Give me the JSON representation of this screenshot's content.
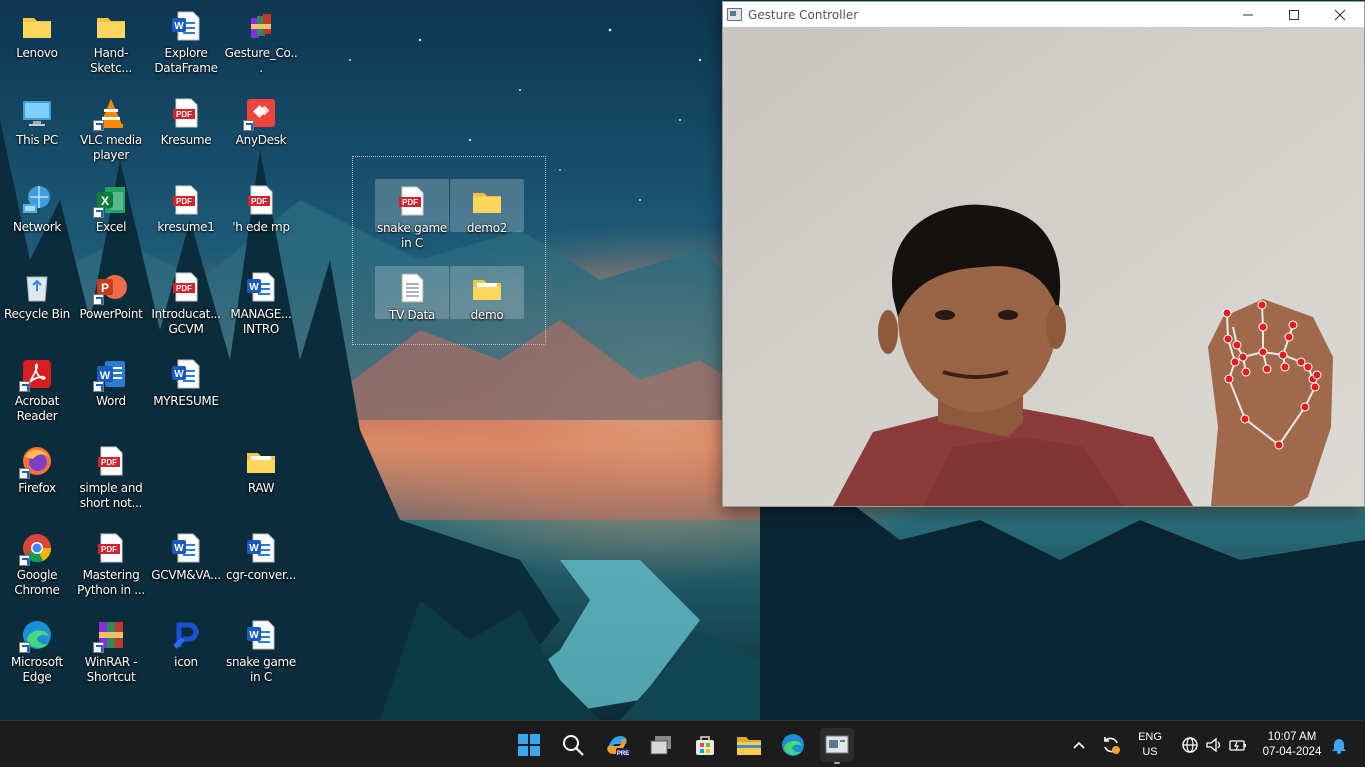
{
  "desktop": {
    "icons": [
      {
        "label": "Lenovo",
        "icon": "folder-icon"
      },
      {
        "label": "Hand-Sketc...",
        "icon": "folder-icon"
      },
      {
        "label": "Explore DataFrame",
        "icon": "word-doc-icon"
      },
      {
        "label": "Gesture_Co...",
        "icon": "winrar-archive-icon"
      },
      {
        "label": "This PC",
        "icon": "monitor-icon"
      },
      {
        "label": "VLC media player",
        "icon": "vlc-icon"
      },
      {
        "label": "Kresume",
        "icon": "pdf-icon"
      },
      {
        "label": "AnyDesk",
        "icon": "anydesk-icon"
      },
      {
        "label": "Network",
        "icon": "network-icon"
      },
      {
        "label": "Excel",
        "icon": "excel-icon"
      },
      {
        "label": "kresume1",
        "icon": "pdf-icon"
      },
      {
        "label": "'h ede mp",
        "icon": "pdf-icon"
      },
      {
        "label": "Recycle Bin",
        "icon": "recycle-bin-icon"
      },
      {
        "label": "PowerPoint",
        "icon": "powerpoint-icon"
      },
      {
        "label": "Introducat... GCVM",
        "icon": "pdf-icon"
      },
      {
        "label": "MANAGE... INTRO",
        "icon": "word-doc-icon"
      },
      {
        "label": "Acrobat Reader",
        "icon": "acrobat-icon"
      },
      {
        "label": "Word",
        "icon": "word-icon"
      },
      {
        "label": "MYRESUME",
        "icon": "word-doc-icon"
      },
      {
        "label": "Firefox",
        "icon": "firefox-icon"
      },
      {
        "label": "simple and short not...",
        "icon": "pdf-icon"
      },
      {
        "label": "RAW",
        "icon": "folder-icon"
      },
      {
        "label": "Google Chrome",
        "icon": "chrome-icon"
      },
      {
        "label": "Mastering Python in ...",
        "icon": "pdf-icon"
      },
      {
        "label": "GCVM&VA...",
        "icon": "word-doc-icon"
      },
      {
        "label": "cgr-conver...",
        "icon": "word-doc-icon"
      },
      {
        "label": "Microsoft Edge",
        "icon": "edge-icon"
      },
      {
        "label": "WinRAR - Shortcut",
        "icon": "winrar-icon"
      },
      {
        "label": "icon",
        "icon": "p-logo-icon"
      },
      {
        "label": "snake game in C",
        "icon": "word-doc-icon"
      }
    ],
    "selected_icons": [
      {
        "label": "snake game in C",
        "icon": "pdf-icon"
      },
      {
        "label": "demo2",
        "icon": "folder-icon"
      },
      {
        "label": "TV Data",
        "icon": "text-doc-icon"
      },
      {
        "label": "demo",
        "icon": "folder-icon"
      }
    ]
  },
  "window": {
    "title": "Gesture Controller",
    "minimize_label": "minimize",
    "maximize_label": "maximize",
    "close_label": "close"
  },
  "taskbar": {
    "apps": [
      "windows-start-icon",
      "search-icon",
      "copilot-icon",
      "task-view-icon",
      "microsoft-store-icon",
      "file-explorer-icon",
      "edge-icon",
      "gesture-controller-icon"
    ],
    "tray": {
      "lang_top": "ENG",
      "lang_bottom": "US",
      "time": "10:07 AM",
      "date": "07-04-2024"
    }
  }
}
